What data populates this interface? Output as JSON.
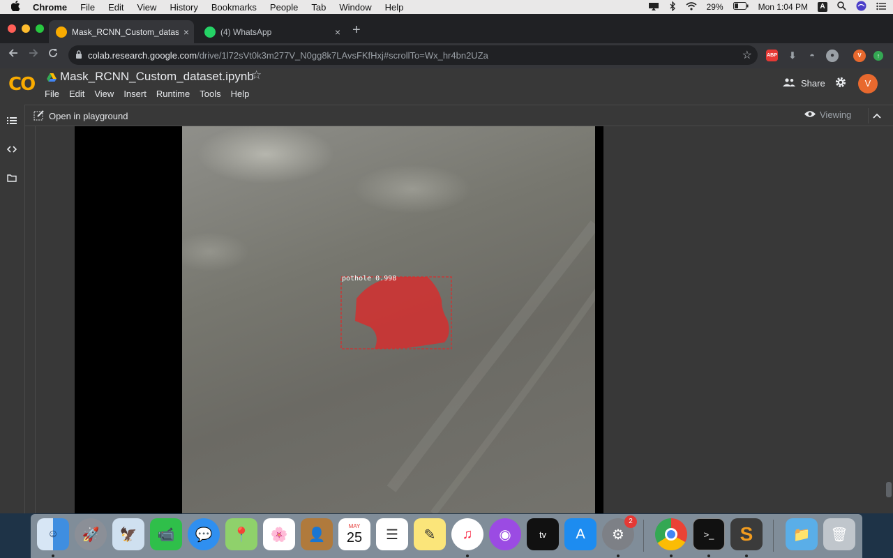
{
  "menubar": {
    "apple": "",
    "app": "Chrome",
    "items": [
      "File",
      "Edit",
      "View",
      "History",
      "Bookmarks",
      "People",
      "Tab",
      "Window",
      "Help"
    ],
    "battery": "29%",
    "clock": "Mon 1:04 PM",
    "input_badge": "A"
  },
  "browser": {
    "tabs": [
      {
        "title": "Mask_RCNN_Custom_dataset.i",
        "favicon": "colab-icon",
        "active": true
      },
      {
        "title": "(4) WhatsApp",
        "favicon": "whatsapp-icon",
        "active": false
      }
    ],
    "close_glyph": "×",
    "new_tab": "+",
    "url_host": "colab.research.google.com",
    "url_path": "/drive/1l72sVt0k3m277V_N0gg8k7LAvsFKfHxj#scrollTo=Wx_hr4bn2UZa",
    "extensions": [
      "ABP",
      "V"
    ]
  },
  "colab": {
    "logo": "CO",
    "notebook_title": "Mask_RCNN_Custom_dataset.ipynb",
    "menu": [
      "File",
      "Edit",
      "View",
      "Insert",
      "Runtime",
      "Tools",
      "Help"
    ],
    "share_label": "Share",
    "avatar_letter": "V",
    "open_playground": "Open in playground",
    "viewing_label": "Viewing",
    "detection_label": "pothole 0.998"
  },
  "dock": {
    "calendar_month": "MAY",
    "calendar_day": "25",
    "system_prefs_badge": "2",
    "tv_label": "tv"
  },
  "colors": {
    "mask": "#d32f2f",
    "avatar": "#e8692e",
    "colab_logo": "#f9ab00"
  }
}
